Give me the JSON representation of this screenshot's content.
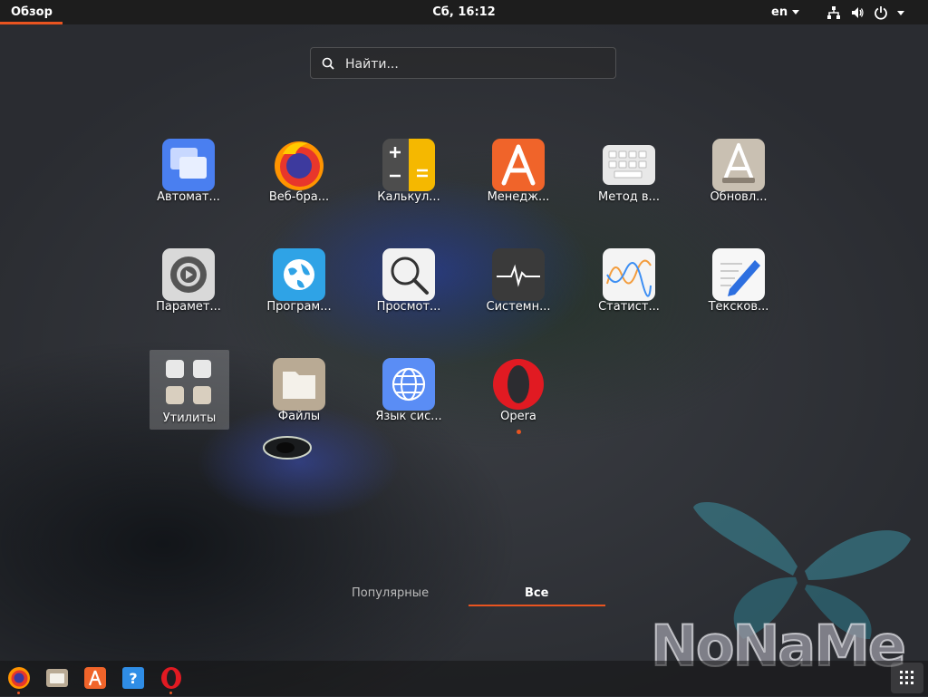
{
  "topbar": {
    "activities": "Обзор",
    "clock": "Сб, 16:12",
    "language": "en"
  },
  "search": {
    "placeholder": "Найти..."
  },
  "apps": [
    {
      "label": "Автомат..."
    },
    {
      "label": "Веб-бра..."
    },
    {
      "label": "Калькул..."
    },
    {
      "label": "Менедж..."
    },
    {
      "label": "Метод в..."
    },
    {
      "label": "Обновл..."
    },
    {
      "label": "Парамет..."
    },
    {
      "label": "Програм..."
    },
    {
      "label": "Просмот..."
    },
    {
      "label": "Системн..."
    },
    {
      "label": "Статист..."
    },
    {
      "label": "Тексков..."
    },
    {
      "label": "Утилиты"
    },
    {
      "label": "Файлы"
    },
    {
      "label": "Язык сис..."
    },
    {
      "label": "Opera"
    }
  ],
  "tabs": {
    "popular": "Популярные",
    "all": "Все"
  },
  "watermark": "NoNaMe",
  "colors": {
    "accent": "#e95420",
    "topbar": "#1d1d1d"
  }
}
